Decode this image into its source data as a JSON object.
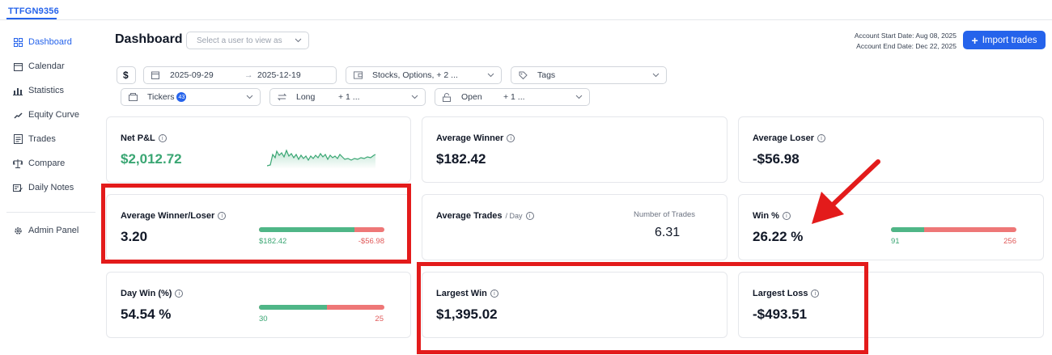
{
  "topbar": {
    "user_tab": "TTFGN9356"
  },
  "sidebar": {
    "items": [
      {
        "label": "Dashboard",
        "icon": "dashboard-icon"
      },
      {
        "label": "Calendar",
        "icon": "calendar-icon"
      },
      {
        "label": "Statistics",
        "icon": "statistics-icon"
      },
      {
        "label": "Equity Curve",
        "icon": "equity-curve-icon"
      },
      {
        "label": "Trades",
        "icon": "trades-icon"
      },
      {
        "label": "Compare",
        "icon": "compare-icon"
      },
      {
        "label": "Daily Notes",
        "icon": "daily-notes-icon"
      }
    ],
    "admin": {
      "label": "Admin Panel",
      "icon": "gear-icon"
    }
  },
  "header": {
    "title": "Dashboard",
    "user_select_placeholder": "Select a user to view as",
    "account_start_label": "Account Start Date:",
    "account_start_value": "Aug 08, 2025",
    "account_end_label": "Account End Date:",
    "account_end_value": "Dec 22, 2025",
    "import_label": "Import trades"
  },
  "filters": {
    "currency": "$",
    "date_from": "2025-09-29",
    "date_arrow": "→",
    "date_to": "2025-12-19",
    "asset_types": "Stocks, Options, + 2 ...",
    "tags": "Tags",
    "tickers": "Tickers",
    "tickers_count": "43",
    "side_value": "Long",
    "side_more": "+ 1 ...",
    "status_value": "Open",
    "status_more": "+ 1 ..."
  },
  "cards": {
    "net_pnl": {
      "label": "Net P&L",
      "value": "$2,012.72"
    },
    "avg_winner": {
      "label": "Average Winner",
      "value": "$182.42"
    },
    "avg_loser": {
      "label": "Average Loser",
      "value": "-$56.98"
    },
    "avg_winner_loser": {
      "label": "Average Winner/Loser",
      "value": "3.20",
      "left": "$182.42",
      "right": "-$56.98",
      "win_fraction": 0.76
    },
    "avg_trades": {
      "label": "Average Trades",
      "sub": "/ Day",
      "meta_label": "Number of Trades",
      "meta_value": "6.31"
    },
    "win_pct": {
      "label": "Win %",
      "value": "26.22 %",
      "left": "91",
      "right": "256",
      "win_fraction": 0.262
    },
    "day_win": {
      "label": "Day Win (%)",
      "value": "54.54 %",
      "left": "30",
      "right": "25",
      "win_fraction": 0.545
    },
    "largest_win": {
      "label": "Largest Win",
      "value": "$1,395.02"
    },
    "largest_loss": {
      "label": "Largest Loss",
      "value": "-$493.51"
    }
  },
  "colors": {
    "accent": "#2563eb",
    "positive": "#3aa673",
    "negative": "#e05a5a",
    "highlight": "#e31b1b"
  }
}
